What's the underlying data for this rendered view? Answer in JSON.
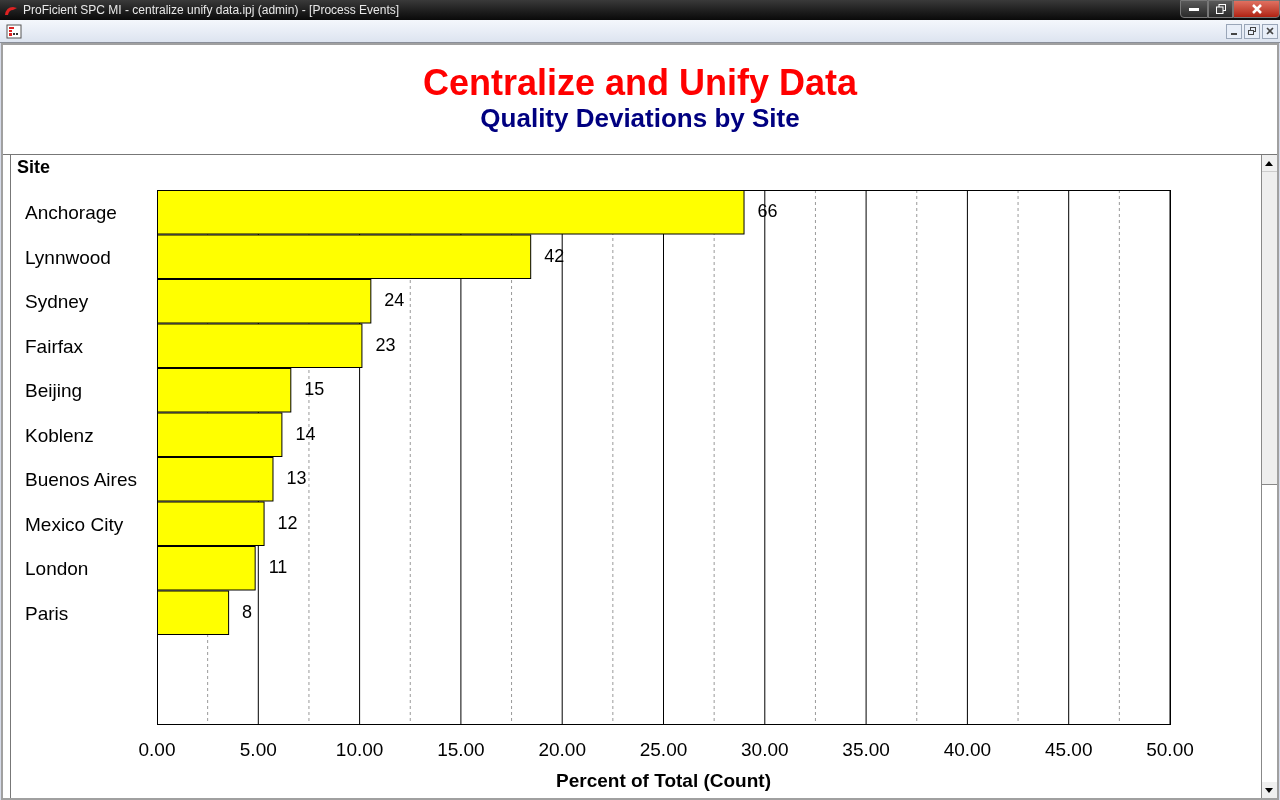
{
  "window": {
    "title": "ProFicient SPC MI - centralize unify data.ipj (admin) - [Process Events]"
  },
  "header": {
    "title": "Centralize and Unify Data",
    "subtitle": "Quality Deviations by Site"
  },
  "chart_data": {
    "type": "bar",
    "orientation": "horizontal",
    "ylabel": "Site",
    "xlabel": "Percent of Total (Count)",
    "categories": [
      "Anchorage",
      "Lynnwood",
      "Sydney",
      "Fairfax",
      "Beijing",
      "Koblenz",
      "Buenos Aires",
      "Mexico City",
      "London",
      "Paris"
    ],
    "grid": true,
    "series": [
      {
        "color": "#ffff00",
        "values": [
          28.95,
          18.42,
          10.53,
          10.09,
          6.58,
          6.14,
          5.7,
          5.26,
          4.82,
          3.51
        ]
      }
    ],
    "value_labels": [
      "66",
      "42",
      "24",
      "23",
      "15",
      "14",
      "13",
      "12",
      "11",
      "8"
    ],
    "xlim": [
      0,
      50
    ],
    "xticks": [
      {
        "value": 0,
        "label": "0.00"
      },
      {
        "value": 5,
        "label": "5.00"
      },
      {
        "value": 10,
        "label": "10.00"
      },
      {
        "value": 15,
        "label": "15.00"
      },
      {
        "value": 20,
        "label": "20.00"
      },
      {
        "value": 25,
        "label": "25.00"
      },
      {
        "value": 30,
        "label": "30.00"
      },
      {
        "value": 35,
        "label": "35.00"
      },
      {
        "value": 40,
        "label": "40.00"
      },
      {
        "value": 45,
        "label": "45.00"
      },
      {
        "value": 50,
        "label": "50.00"
      }
    ]
  }
}
